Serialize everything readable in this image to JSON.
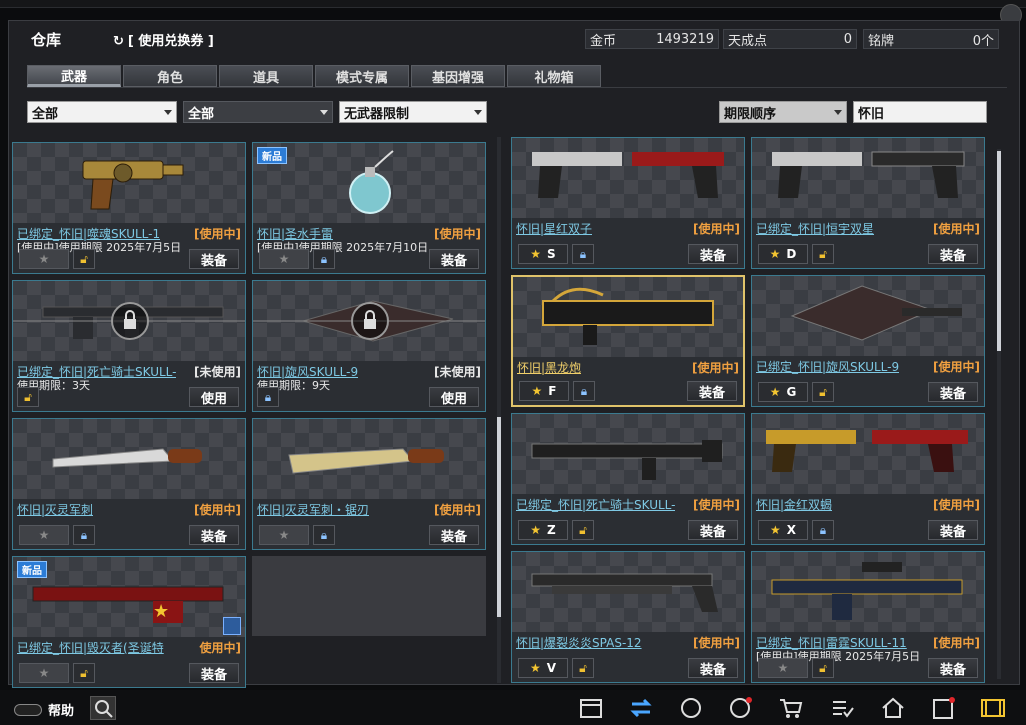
{
  "header": {
    "title": "仓库",
    "redeem_label": "[ 使用兑换券 ]",
    "stats": [
      {
        "label": "金币",
        "value": "1493219"
      },
      {
        "label": "天成点",
        "value": "0"
      },
      {
        "label": "铭牌",
        "value": "0个"
      }
    ]
  },
  "tabs": [
    {
      "label": "武器",
      "active": true
    },
    {
      "label": "角色"
    },
    {
      "label": "道具"
    },
    {
      "label": "模式专属"
    },
    {
      "label": "基因增强"
    },
    {
      "label": "礼物箱"
    }
  ],
  "filters": {
    "filter1": "全部",
    "filter2": "全部",
    "filter3": "无武器限制",
    "sort": "期限顺序",
    "search_value": "怀旧"
  },
  "left_items": [
    {
      "name": "已绑定_怀旧|噬魂SKULL-1",
      "status": "[使用中]",
      "info": "[使用中]使用期限 2025年7月5日",
      "button": "装备"
    },
    {
      "name": "怀旧|圣水手雷",
      "status": "[使用中]",
      "info": "[使用中]使用期限 2025年7月10日",
      "button": "装备",
      "tag": "新品"
    },
    {
      "name": "已绑定_怀旧|死亡骑士SKULL-",
      "status": "[未使用]",
      "info": "使用期限：3天",
      "button": "使用"
    },
    {
      "name": "怀旧|旋风SKULL-9",
      "status": "[未使用]",
      "info": "使用期限：9天",
      "button": "使用"
    },
    {
      "name": "怀旧|灭灵军刺",
      "status": "[使用中]",
      "info": "",
      "button": "装备"
    },
    {
      "name": "怀旧|灭灵军刺・锯刃",
      "status": "[使用中]",
      "info": "",
      "button": "装备"
    },
    {
      "name": "已绑定_怀旧|毁灭者(圣诞特",
      "status": "使用中]",
      "info": "",
      "button": "装备",
      "tag": "新品"
    }
  ],
  "right_items": [
    {
      "name": "怀旧|星红双子",
      "status": "[使用中]",
      "hotkey": "S",
      "button": "装备"
    },
    {
      "name": "已绑定_怀旧|恒宇双星",
      "status": "[使用中]",
      "hotkey": "D",
      "button": "装备"
    },
    {
      "name": "怀旧|黑龙炮",
      "status": "[使用中]",
      "hotkey": "F",
      "button": "装备"
    },
    {
      "name": "已绑定_怀旧|旋风SKULL-9",
      "status": "[使用中]",
      "hotkey": "G",
      "button": "装备"
    },
    {
      "name": "已绑定_怀旧|死亡骑士SKULL-",
      "status": "[使用中]",
      "hotkey": "Z",
      "button": "装备"
    },
    {
      "name": "怀旧|金红双蝎",
      "status": "[使用中]",
      "hotkey": "X",
      "button": "装备"
    },
    {
      "name": "怀旧|爆裂炎炎SPAS-12",
      "status": "[使用中]",
      "hotkey": "V",
      "button": "装备"
    },
    {
      "name": "已绑定_怀旧|雷霆SKULL-11",
      "status": "[使用中]",
      "info": "[使用中]使用期限 2025年7月5日",
      "button": "装备"
    }
  ],
  "bottom": {
    "help_label": "帮助"
  },
  "icons": [
    "calendar-icon",
    "swap-icon",
    "compass-icon",
    "rank-icon",
    "shop-cart-icon",
    "checklist-icon",
    "home-icon",
    "clipboard-icon",
    "film-icon"
  ]
}
